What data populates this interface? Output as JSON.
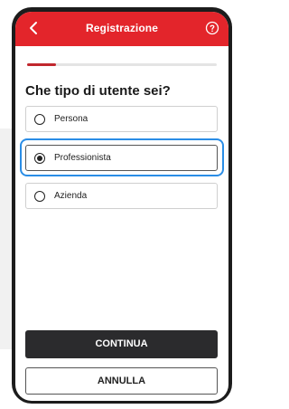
{
  "header": {
    "title": "Registrazione",
    "back_icon": "chevron-left-icon",
    "help_icon": "help-circle-icon",
    "color": "#e3252b"
  },
  "progress": {
    "fraction": 0.15,
    "color": "#c1272d"
  },
  "question": "Che tipo di utente sei?",
  "options": [
    {
      "label": "Persona",
      "selected": false
    },
    {
      "label": "Professionista",
      "selected": true
    },
    {
      "label": "Azienda",
      "selected": false
    }
  ],
  "focus_color": "#2a8de6",
  "buttons": {
    "continue_label": "CONTINUA",
    "cancel_label": "ANNULLA"
  }
}
